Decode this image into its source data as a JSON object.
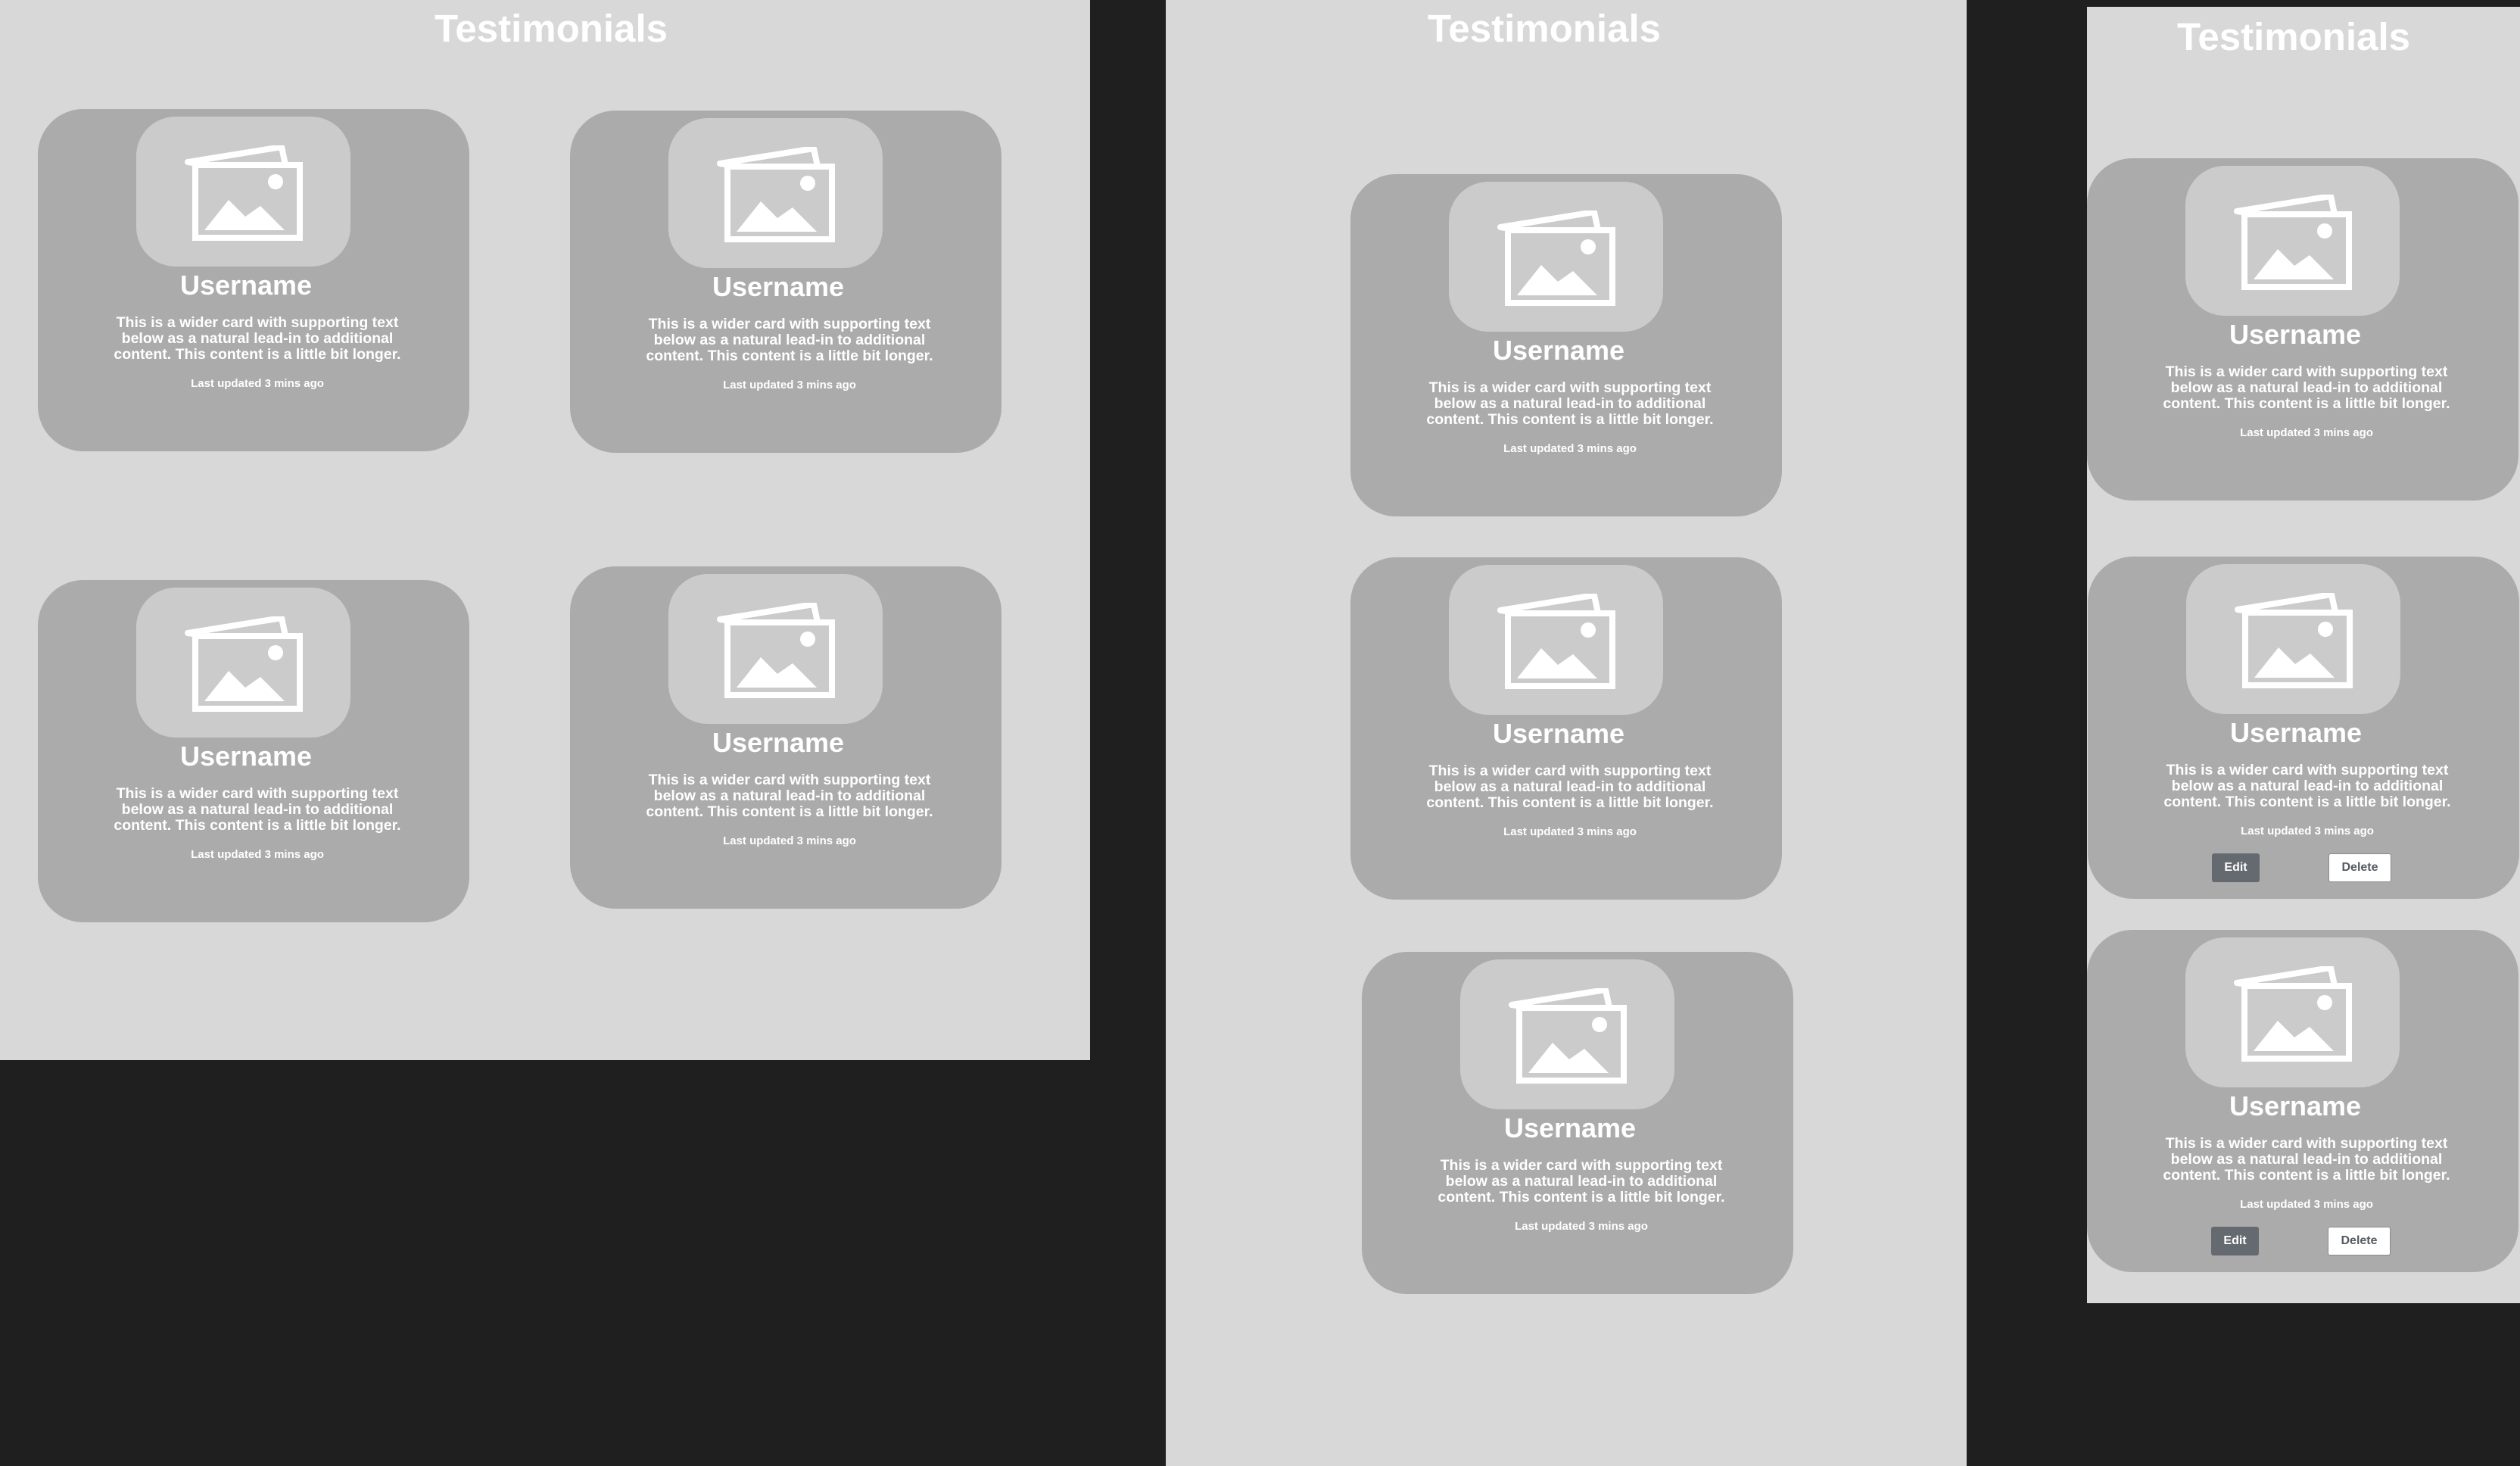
{
  "frames": [
    {
      "title": "Testimonials",
      "cards": [
        {
          "username": "Username",
          "text": "This is a wider card with supporting text below as a natural lead-in to additional content. This content is a little bit longer.",
          "meta": "Last updated 3 mins ago"
        },
        {
          "username": "Username",
          "text": "This is a wider card with supporting text below as a natural lead-in to additional content. This content is a little bit longer.",
          "meta": "Last updated 3 mins ago"
        },
        {
          "username": "Username",
          "text": "This is a wider card with supporting text below as a natural lead-in to additional content. This content is a little bit longer.",
          "meta": "Last updated 3 mins ago"
        },
        {
          "username": "Username",
          "text": "This is a wider card with supporting text below as a natural lead-in to additional content. This content is a little bit longer.",
          "meta": "Last updated 3 mins ago"
        }
      ]
    },
    {
      "title": "Testimonials",
      "cards": [
        {
          "username": "Username",
          "text": "This is a wider card with supporting text below as a natural lead-in to additional content. This content is a little bit longer.",
          "meta": "Last updated 3 mins ago"
        },
        {
          "username": "Username",
          "text": "This is a wider card with supporting text below as a natural lead-in to additional content. This content is a little bit longer.",
          "meta": "Last updated 3 mins ago"
        },
        {
          "username": "Username",
          "text": "This is a wider card with supporting text below as a natural lead-in to additional content. This content is a little bit longer.",
          "meta": "Last updated 3 mins ago"
        }
      ]
    },
    {
      "title": "Testimonials",
      "cards": [
        {
          "username": "Username",
          "text": "This is a wider card with supporting text below as a natural lead-in to additional content. This content is a little bit longer.",
          "meta": "Last updated 3 mins ago"
        },
        {
          "username": "Username",
          "text": "This is a wider card with supporting text below as a natural lead-in to additional content. This content is a little bit longer.",
          "meta": "Last updated 3 mins ago",
          "edit_label": "Edit",
          "delete_label": "Delete"
        },
        {
          "username": "Username",
          "text": "This is a wider card with supporting text below as a natural lead-in to additional content. This content is a little bit longer.",
          "meta": "Last updated 3 mins ago",
          "edit_label": "Edit",
          "delete_label": "Delete"
        }
      ]
    }
  ],
  "icons": {
    "card_image": "image-placeholder-icon"
  },
  "colors": {
    "page_bg": "#1f1f1f",
    "frame_bg": "#d8d8d8",
    "card_bg": "#ababab",
    "photo_bg": "#cbcbcb",
    "edit_button": "#646a70"
  }
}
